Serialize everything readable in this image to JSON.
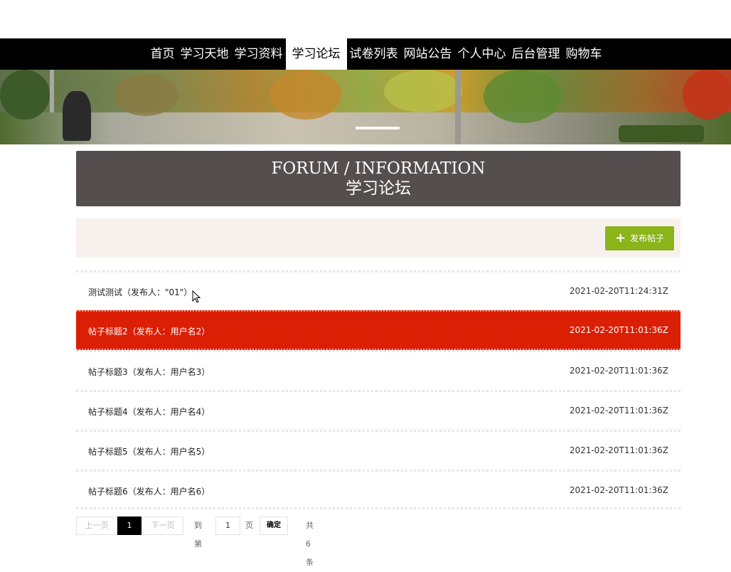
{
  "nav": {
    "items": [
      {
        "label": "首页",
        "active": false
      },
      {
        "label": "学习天地",
        "active": false
      },
      {
        "label": "学习资料",
        "active": false
      },
      {
        "label": "学习论坛",
        "active": true
      },
      {
        "label": "试卷列表",
        "active": false
      },
      {
        "label": "网站公告",
        "active": false
      },
      {
        "label": "个人中心",
        "active": false
      },
      {
        "label": "后台管理",
        "active": false
      },
      {
        "label": "购物车",
        "active": false
      }
    ]
  },
  "header": {
    "title_en": "FORUM / INFORMATION",
    "title_cn": "学习论坛"
  },
  "actions": {
    "add_post_label": "发布帖子",
    "add_icon": "plus-icon"
  },
  "posts": [
    {
      "title": "测试测试（发布人：\"01\"）",
      "date": "2021-02-20T11:24:31Z",
      "highlighted": false
    },
    {
      "title": "帖子标题2（发布人：用户名2）",
      "date": "2021-02-20T11:01:36Z",
      "highlighted": true
    },
    {
      "title": "帖子标题3（发布人：用户名3）",
      "date": "2021-02-20T11:01:36Z",
      "highlighted": false
    },
    {
      "title": "帖子标题4（发布人：用户名4）",
      "date": "2021-02-20T11:01:36Z",
      "highlighted": false
    },
    {
      "title": "帖子标题5（发布人：用户名5）",
      "date": "2021-02-20T11:01:36Z",
      "highlighted": false
    },
    {
      "title": "帖子标题6（发布人：用户名6）",
      "date": "2021-02-20T11:01:36Z",
      "highlighted": false
    }
  ],
  "pagination": {
    "prev_label": "上一页",
    "current_page": "1",
    "next_label": "下一页",
    "goto_label": "到第",
    "goto_value": "1",
    "page_unit": "页",
    "confirm_label": "确定",
    "total_label": "共 6 条"
  },
  "colors": {
    "nav_bg": "#000000",
    "title_bg": "#554e4e",
    "highlight_row": "#da1f05",
    "add_button": "#8ab419",
    "action_bar_bg": "#f7f1ee"
  }
}
